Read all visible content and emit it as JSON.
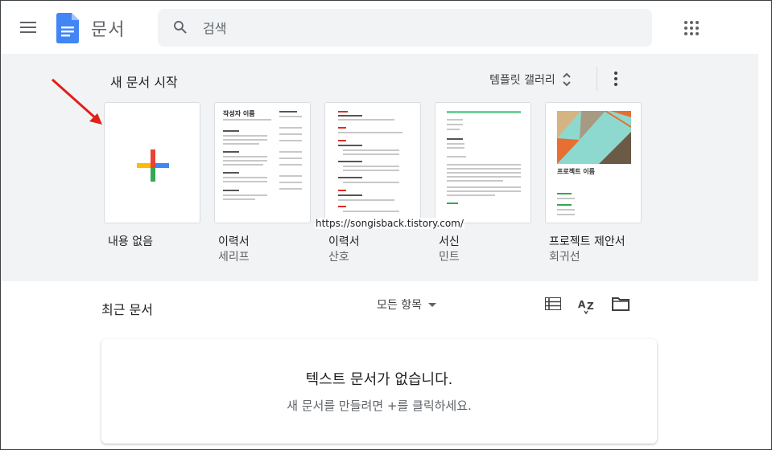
{
  "header": {
    "app_title": "문서",
    "search_placeholder": "검색"
  },
  "templates": {
    "heading": "새 문서 시작",
    "gallery_label": "템플릿 갤러리",
    "items": [
      {
        "name": "내용 없음",
        "sub": ""
      },
      {
        "name": "이력서",
        "sub": "세리프",
        "thumb_title": "작성자 이름"
      },
      {
        "name": "이력서",
        "sub": "산호"
      },
      {
        "name": "서신",
        "sub": "민트"
      },
      {
        "name": "프로젝트 제안서",
        "sub": "회귀선",
        "thumb_title": "프로젝트 이름"
      }
    ]
  },
  "watermark": "https://songisback.tistory.com/",
  "recent": {
    "heading": "최근 문서",
    "owner_filter": "모든 항목",
    "empty_title": "텍스트 문서가 없습니다.",
    "empty_sub": "새 문서를 만들려면 +를 클릭하세요."
  },
  "colors": {
    "docs_blue": "#4285f4",
    "surface": "#f1f3f4",
    "annotation_red": "#e0201a"
  }
}
